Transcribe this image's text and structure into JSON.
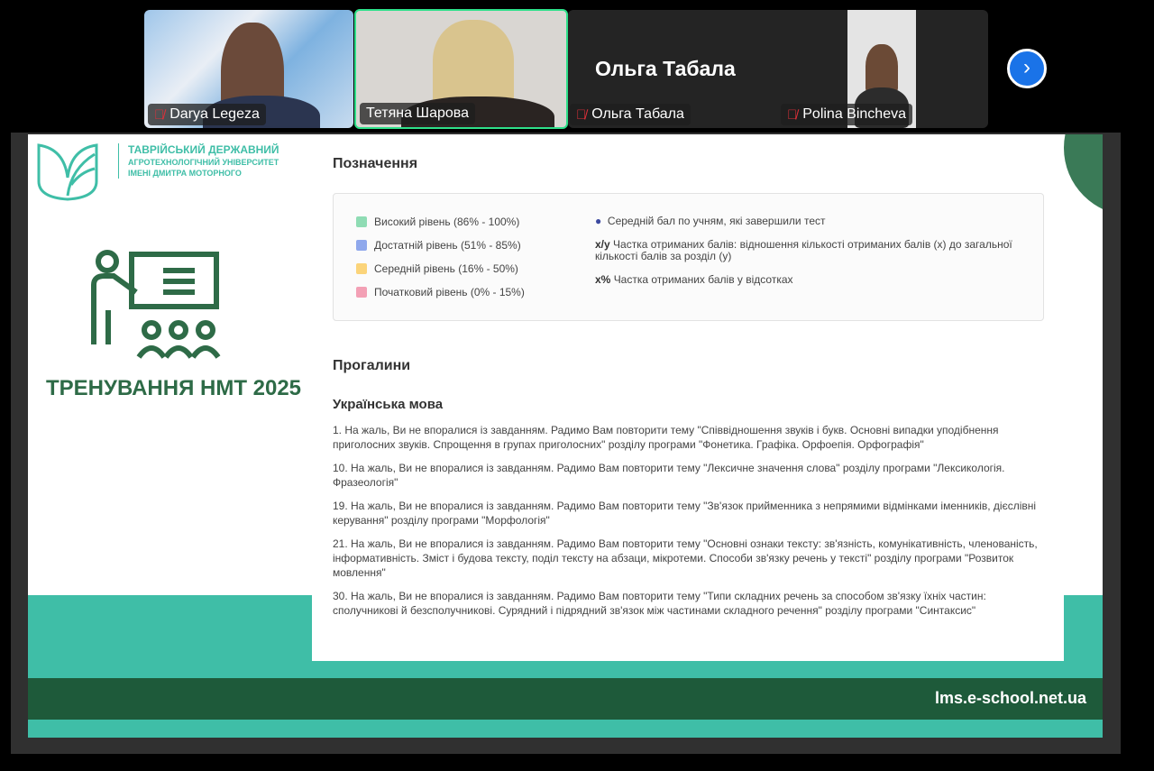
{
  "participants": [
    {
      "name": "Darya Legeza",
      "muted": true
    },
    {
      "name": "Тетяна Шарова",
      "muted": false,
      "speaking": true
    },
    {
      "name": "Ольга Табала",
      "muted": true,
      "display_name": "Ольга Табала"
    },
    {
      "name": "Polina Bincheva",
      "muted": true
    }
  ],
  "next_icon": "chevron-right-icon",
  "slide": {
    "logo": {
      "line1": "ТАВРІЙСЬКИЙ ДЕРЖАВНИЙ",
      "line2": "АГРОТЕХНОЛОГІЧНИЙ УНІВЕРСИТЕТ",
      "line3": "ІМЕНІ ДМИТРА МОТОРНОГО"
    },
    "training_title": "ТРЕНУВАННЯ НМТ 2025",
    "footer_url": "lms.e-school.net.ua",
    "legend_title": "Позначення",
    "levels": [
      {
        "label": "Високий рівень (86% - 100%)",
        "color": "#8fdcb4"
      },
      {
        "label": "Достатній рівень (51% - 85%)",
        "color": "#8fa8ec"
      },
      {
        "label": "Середній рівень (16% - 50%)",
        "color": "#fbd47a"
      },
      {
        "label": "Початковий рівень (0% - 15%)",
        "color": "#f3a0b5"
      }
    ],
    "notes": {
      "avg": "Середній бал по учням, які завершили тест",
      "xy_key": "x/y",
      "xy": "Частка отриманих балів: відношення кількості отриманих балів (x) до загальної кількості балів за розділ (y)",
      "pct_key": "x%",
      "pct": "Частка отриманих балів у відсотках"
    },
    "gaps_title": "Прогалини",
    "subject": "Українська мова",
    "messages": [
      "1. На жаль, Ви не впоралися із завданням. Радимо Вам повторити тему \"Співвідношення звуків і букв. Основні випадки уподібнення приголосних звуків. Спрощення в групах приголосних\" розділу програми \"Фонетика. Графіка. Орфоепія. Орфографія\"",
      "10. На жаль, Ви не впоралися із завданням. Радимо Вам повторити тему \"Лексичне значення слова\" розділу програми \"Лексикологія. Фразеологія\"",
      "19. На жаль, Ви не впоралися із завданням. Радимо Вам повторити тему \"Зв'язок прийменника з непрямими відмінками іменників, дієслівні керування\" розділу програми \"Морфологія\"",
      "21. На жаль, Ви не впоралися із завданням. Радимо Вам повторити тему \"Основні ознаки тексту: зв'язність, комунікативність, членованість, інформативність. Зміст і будова тексту, поділ тексту на абзаци, мікротеми. Способи зв'язку речень у тексті\" розділу програми \"Розвиток мовлення\"",
      "30. На жаль, Ви не впоралися із завданням. Радимо Вам повторити тему \"Типи складних речень за способом зв'язку їхніх частин: сполучникові й безсполучникові. Сурядний і підрядний зв'язок між частинами складного речення\" розділу програми \"Синтаксис\""
    ]
  }
}
